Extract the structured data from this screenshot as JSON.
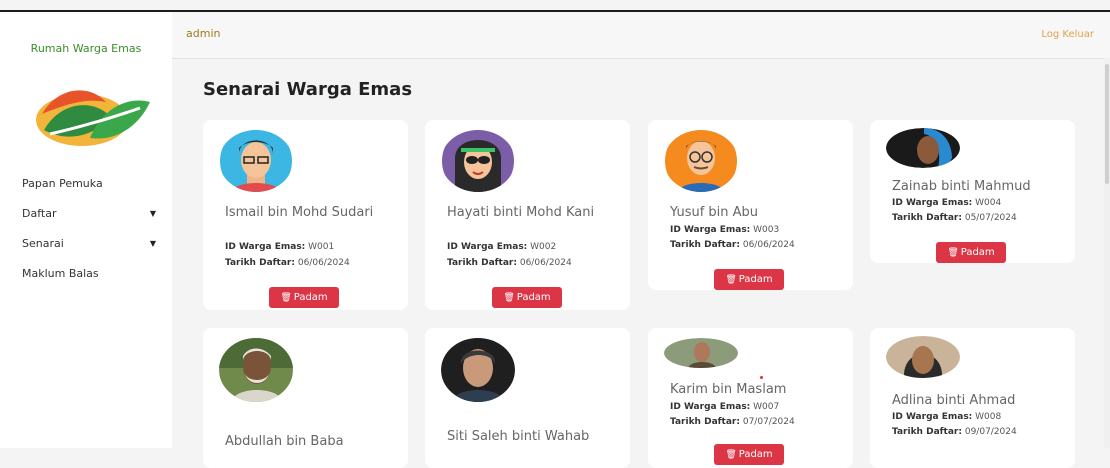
{
  "brand": "Rumah Warga Emas",
  "nav": [
    {
      "label": "Papan Pemuka",
      "has_caret": false
    },
    {
      "label": "Daftar",
      "has_caret": true
    },
    {
      "label": "Senarai",
      "has_caret": true
    },
    {
      "label": "Maklum Balas",
      "has_caret": false
    }
  ],
  "topbar": {
    "user": "admin",
    "logout": "Log Keluar"
  },
  "page_title": "Senarai Warga Emas",
  "labels": {
    "id": "ID Warga Emas:",
    "date": "Tarikh Daftar:",
    "delete": "Padam"
  },
  "residents": [
    {
      "name": "Ismail bin Mohd Sudari",
      "id": "W001",
      "date": "06/06/2024"
    },
    {
      "name": "Hayati binti Mohd Kani",
      "id": "W002",
      "date": "06/06/2024"
    },
    {
      "name": "Yusuf bin Abu",
      "id": "W003",
      "date": "06/06/2024"
    },
    {
      "name": "Zainab binti Mahmud",
      "id": "W004",
      "date": "05/07/2024"
    },
    {
      "name": "Abdullah bin Baba",
      "id": "",
      "date": ""
    },
    {
      "name": "Siti Saleh binti Wahab",
      "id": "",
      "date": ""
    },
    {
      "name": "Karim bin Maslam",
      "id": "W007",
      "date": "07/07/2024"
    },
    {
      "name": "Adlina binti Ahmad",
      "id": "W008",
      "date": "09/07/2024"
    }
  ],
  "colors": {
    "accent_red": "#dc3545",
    "brand_green": "#3b8d2b",
    "logout_orange": "#e0a24a"
  }
}
